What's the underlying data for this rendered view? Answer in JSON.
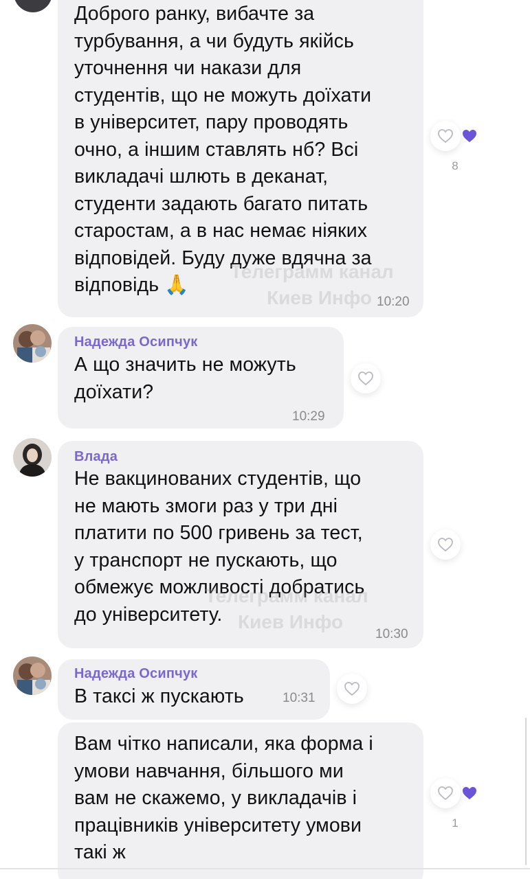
{
  "messages": [
    {
      "text": "Доброго ранку, вибачте за\nтурбування, а чи будуть якійсь\nуточнення чи накази для\nстудентів, що не можуть доїхати\nв університет, пару проводять\nочно, а іншим ставлять нб? Всі\nвикладачі шлють в деканат,\nстуденти задають багато питать\nстаростам, а в нас немає ніяких\nвідповідей. Буду дуже вдячна за\nвідповідь 🙏",
      "time": "10:20",
      "likes": "8"
    },
    {
      "sender": "Надежда Осипчук",
      "text": "А що значить не можуть\nдоїхати?",
      "time": "10:29"
    },
    {
      "sender": "Влада",
      "text": "Не вакцинованих студентів, що\nне мають змоги раз у три дні\nплатити по 500 гривень за тест,\nу транспорт не пускають, що\nобмежує можливості добратись\nдо університету.",
      "time": "10:30"
    },
    {
      "sender": "Надежда Осипчук",
      "text": "В таксі ж пускають",
      "time": "10:31"
    },
    {
      "text": "Вам чітко написали, яка форма і\nумови навчання, більшого ми\nвам не скажемо, у викладачів і\nпрацівників університету умови\nтакі ж",
      "likes": "1"
    }
  ],
  "watermark": {
    "line1": "Телеграмм канал",
    "line2": "Киев Инфо"
  },
  "colors": {
    "bubble": "#f0f0f2",
    "sender_name": "#7a67cf",
    "like_filled": "#6b55d6",
    "time": "#8a8a8e"
  },
  "icons": {
    "reaction": "heart-outline-icon",
    "liked": "heart-filled-icon",
    "prayer": "folded-hands-emoji"
  }
}
